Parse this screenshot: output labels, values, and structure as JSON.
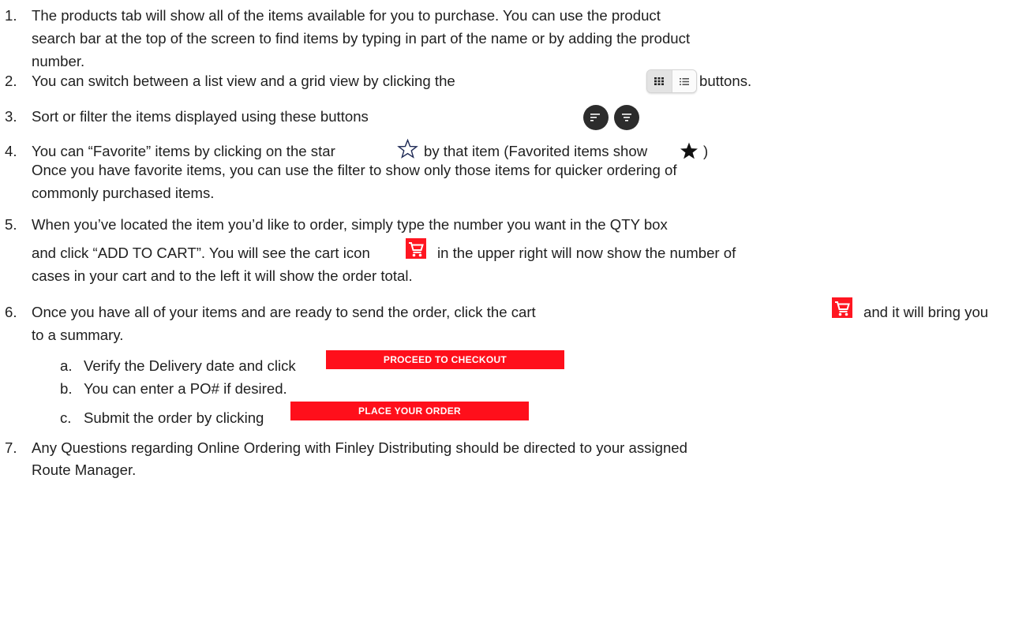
{
  "items": [
    {
      "num": "1.",
      "lines": [
        "The products tab will show all of the items available for you to purchase.  You can use the product",
        "search bar at the top of the screen to find items by typing in part of the name or by adding the product",
        "number."
      ]
    },
    {
      "num": "2.",
      "before": "You can switch between a list view and a grid view by clicking the",
      "after": "buttons."
    },
    {
      "num": "3.",
      "text": "Sort or filter the items displayed using these buttons"
    },
    {
      "num": "4.",
      "before": "You can “Favorite” items by clicking on the star",
      "middle": "by that item (Favorited items show",
      "after": ")",
      "lines": [
        "Once you have favorite items, you can use the filter to show only those items for quicker ordering of",
        "commonly purchased items."
      ]
    },
    {
      "num": "5.",
      "line1": "When you’ve located the item you’d like to order, simply type the number you want in the QTY box",
      "line2_before": "and click “ADD TO CART”. You will see the cart icon",
      "line2_after": "in the upper right will now show the number of",
      "line3": "cases in your cart and to the left it will show the order total."
    },
    {
      "num": "6.",
      "before": "Once you have all of your items and are ready to send the order, click the cart",
      "after": "and it will bring you",
      "line2": "to a summary.",
      "sub": [
        {
          "num": "a.",
          "text": "Verify the Delivery date and click",
          "button": "PROCEED TO CHECKOUT"
        },
        {
          "num": "b.",
          "text": "You can enter a PO# if desired."
        },
        {
          "num": "c.",
          "text": "Submit the order by clicking",
          "button": "PLACE YOUR ORDER"
        }
      ]
    },
    {
      "num": "7.",
      "lines": [
        "Any Questions regarding Online Ordering with Finley Distributing should be directed to your assigned",
        "Route Manager."
      ]
    }
  ],
  "icons": {
    "view_toggle": [
      "grid-view-icon",
      "list-view-icon"
    ],
    "sort": "sort-icon",
    "filter": "filter-icon",
    "star_outline": "star-outline-icon",
    "star_filled": "star-filled-icon",
    "cart": "cart-icon"
  },
  "colors": {
    "accent_red": "#ff0f1b",
    "round_button": "#2c2c2c",
    "text": "#1f1f1f"
  }
}
